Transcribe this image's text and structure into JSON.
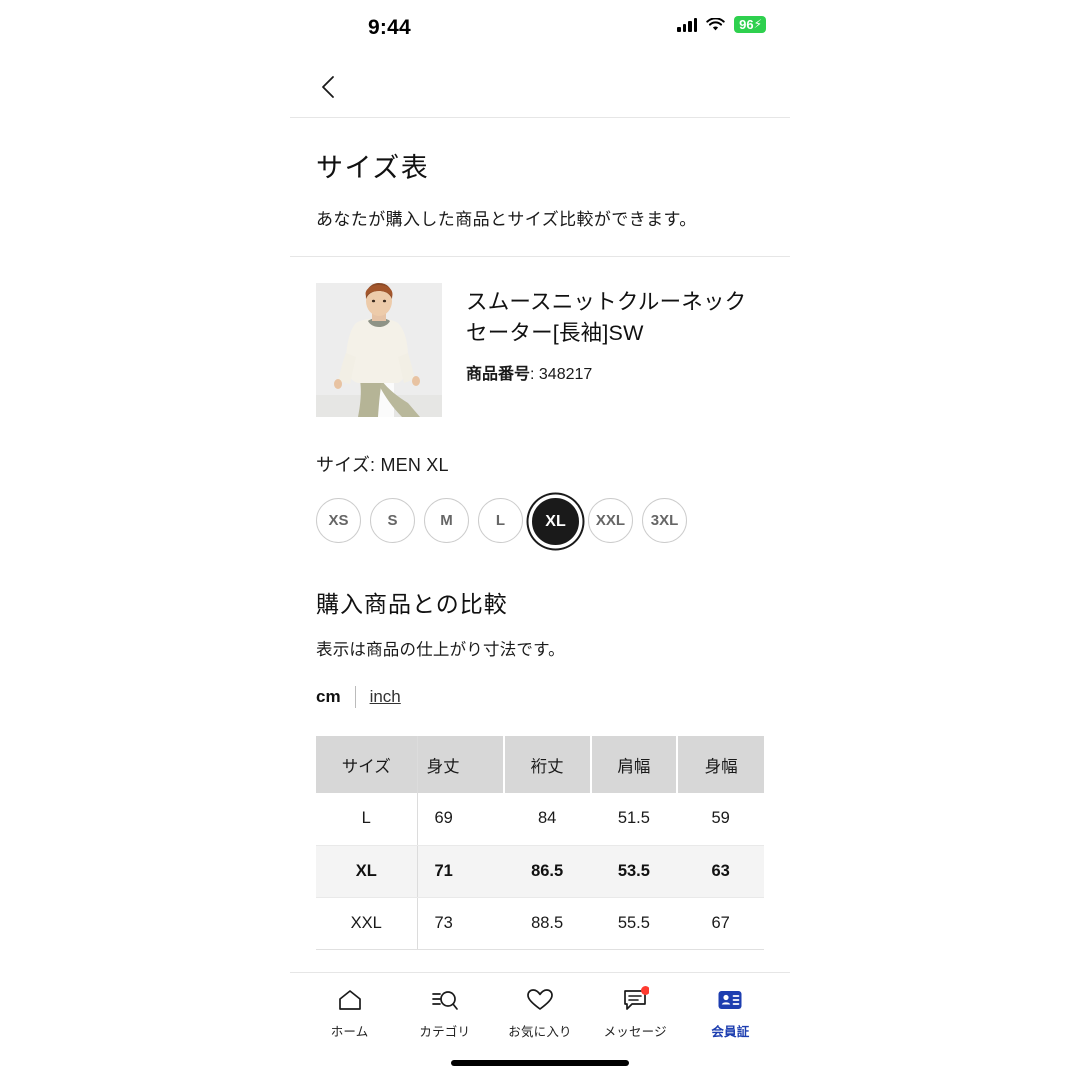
{
  "status_bar": {
    "time": "9:44",
    "battery_level": "96",
    "battery_charging_glyph": "⚡",
    "signal_icon": "cellular-signal-icon",
    "wifi_icon": "wifi-icon"
  },
  "header": {
    "back_icon": "chevron-left-icon"
  },
  "page": {
    "title": "サイズ表",
    "subtitle": "あなたが購入した商品とサイズ比較ができます。"
  },
  "product": {
    "name": "スムースニットクルーネックセーター[長袖]SW",
    "item_number_label": "商品番号",
    "item_number": ": 348217",
    "thumbnail_alt": "model-wearing-cream-sweater"
  },
  "size_selection": {
    "label": "サイズ: MEN XL",
    "options": [
      "XS",
      "S",
      "M",
      "L",
      "XL",
      "XXL",
      "3XL"
    ],
    "selected": "XL"
  },
  "comparison": {
    "title": "購入商品との比較",
    "subtitle": "表示は商品の仕上がり寸法です。",
    "unit_cm": "cm",
    "unit_inch": "inch",
    "active_unit": "cm"
  },
  "table": {
    "headers": [
      "サイズ",
      "身丈",
      "裄丈",
      "肩幅",
      "身幅"
    ],
    "rows": [
      {
        "size": "L",
        "values": [
          "69",
          "84",
          "51.5",
          "59"
        ],
        "highlight": false
      },
      {
        "size": "XL",
        "values": [
          "71",
          "86.5",
          "53.5",
          "63"
        ],
        "highlight": true
      },
      {
        "size": "XXL",
        "values": [
          "73",
          "88.5",
          "55.5",
          "67"
        ],
        "highlight": false
      }
    ]
  },
  "bottom_nav": {
    "items": [
      {
        "label": "ホーム",
        "icon": "home-icon",
        "active": false,
        "badge": false
      },
      {
        "label": "カテゴリ",
        "icon": "category-search-icon",
        "active": false,
        "badge": false
      },
      {
        "label": "お気に入り",
        "icon": "heart-icon",
        "active": false,
        "badge": false
      },
      {
        "label": "メッセージ",
        "icon": "message-bubble-icon",
        "active": false,
        "badge": true
      },
      {
        "label": "会員証",
        "icon": "membership-card-icon",
        "active": true,
        "badge": false
      }
    ],
    "active_color": "#1d3eb0",
    "badge_color": "#ff3b30"
  }
}
